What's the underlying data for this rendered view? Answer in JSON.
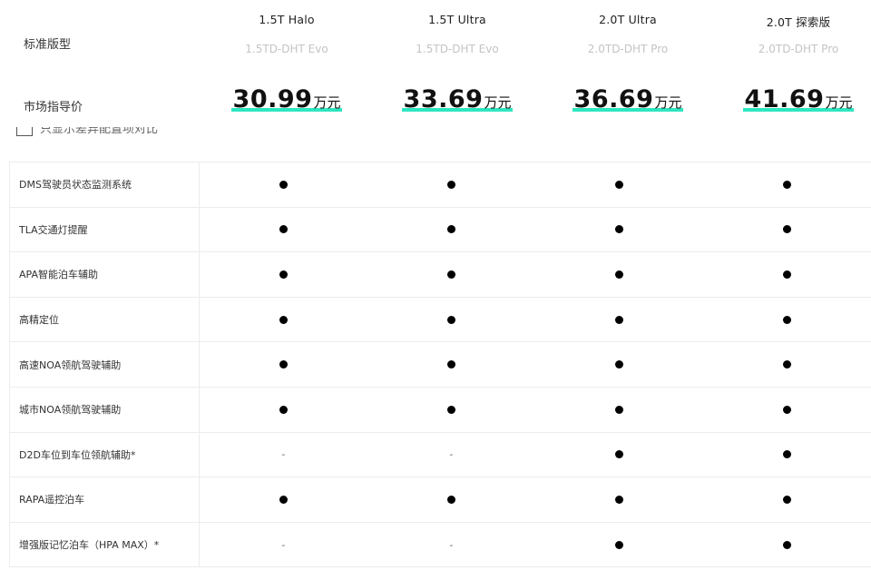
{
  "labels": {
    "standard_model": "标准版型",
    "msrp": "市场指导价"
  },
  "models": [
    {
      "name": "1.5T Halo",
      "engine": "1.5TD-DHT Evo",
      "price": "30.99",
      "unit": "万元"
    },
    {
      "name": "1.5T Ultra",
      "engine": "1.5TD-DHT Evo",
      "price": "33.69",
      "unit": "万元"
    },
    {
      "name": "2.0T Ultra",
      "engine": "2.0TD-DHT Pro",
      "price": "36.69",
      "unit": "万元"
    },
    {
      "name": "2.0T 探索版",
      "engine": "2.0TD-DHT Pro",
      "price": "41.69",
      "unit": "万元"
    }
  ],
  "compare_toggle_text": "只显示差异配置项对比",
  "feature_rows": [
    {
      "feature": "DMS驾驶员状态监测系统",
      "values": [
        "●",
        "●",
        "●",
        "●"
      ]
    },
    {
      "feature": "TLA交通灯提醒",
      "values": [
        "●",
        "●",
        "●",
        "●"
      ]
    },
    {
      "feature": "APA智能泊车辅助",
      "values": [
        "●",
        "●",
        "●",
        "●"
      ]
    },
    {
      "feature": "高精定位",
      "values": [
        "●",
        "●",
        "●",
        "●"
      ]
    },
    {
      "feature": "高速NOA领航驾驶辅助",
      "values": [
        "●",
        "●",
        "●",
        "●"
      ]
    },
    {
      "feature": "城市NOA领航驾驶辅助",
      "values": [
        "●",
        "●",
        "●",
        "●"
      ]
    },
    {
      "feature": "D2D车位到车位领航辅助*",
      "values": [
        "-",
        "-",
        "●",
        "●"
      ]
    },
    {
      "feature": "RAPA遥控泊车",
      "values": [
        "●",
        "●",
        "●",
        "●"
      ]
    },
    {
      "feature": "增强版记忆泊车（HPA MAX）*",
      "values": [
        "-",
        "-",
        "●",
        "●"
      ]
    }
  ],
  "colors": {
    "price_underline": "#2ee6c0",
    "engine_text": "#c4c4c4",
    "grid_line": "#ececec"
  }
}
